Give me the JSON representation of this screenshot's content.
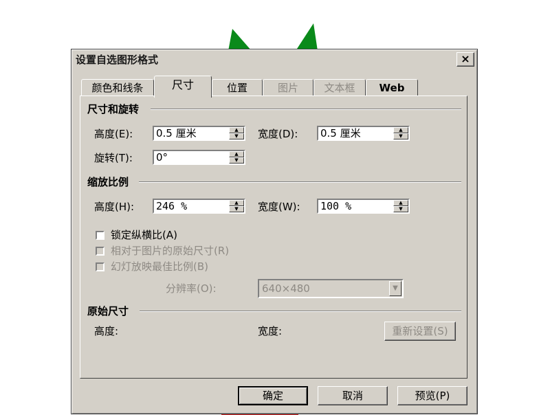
{
  "dialog": {
    "title": "设置自选图形格式",
    "close_label": "×"
  },
  "tabs": [
    {
      "label": "颜色和线条"
    },
    {
      "label": "尺寸"
    },
    {
      "label": "位置"
    },
    {
      "label": "图片"
    },
    {
      "label": "文本框"
    },
    {
      "label": "Web"
    }
  ],
  "size_rotate": {
    "heading": "尺寸和旋转",
    "height_label": "高度(E):",
    "height_value": "0.5 厘米",
    "width_label": "宽度(D):",
    "width_value": "0.5 厘米",
    "rotate_label": "旋转(T):",
    "rotate_value": "0°"
  },
  "scale": {
    "heading": "缩放比例",
    "height_label": "高度(H):",
    "height_value": "246 %",
    "width_label": "宽度(W):",
    "width_value": "100 %",
    "lock_aspect_label": "锁定纵横比(A)",
    "relative_label": "相对于图片的原始尺寸(R)",
    "slideshow_label": "幻灯放映最佳比例(B)",
    "resolution_label": "分辨率(O):",
    "resolution_value": "640×480"
  },
  "original": {
    "heading": "原始尺寸",
    "height_label": "高度:",
    "width_label": "宽度:",
    "reset_label": "重新设置(S)"
  },
  "footer": {
    "ok_label": "确定",
    "cancel_label": "取消",
    "preview_label": "预览(P)"
  },
  "colors": {
    "dialog_bg": "#d4d0c8",
    "shape_green": "#0a8a1a",
    "shape_red": "#d42020"
  },
  "icons": {
    "spin_up": "▲",
    "spin_down": "▼",
    "dropdown": "▼"
  }
}
